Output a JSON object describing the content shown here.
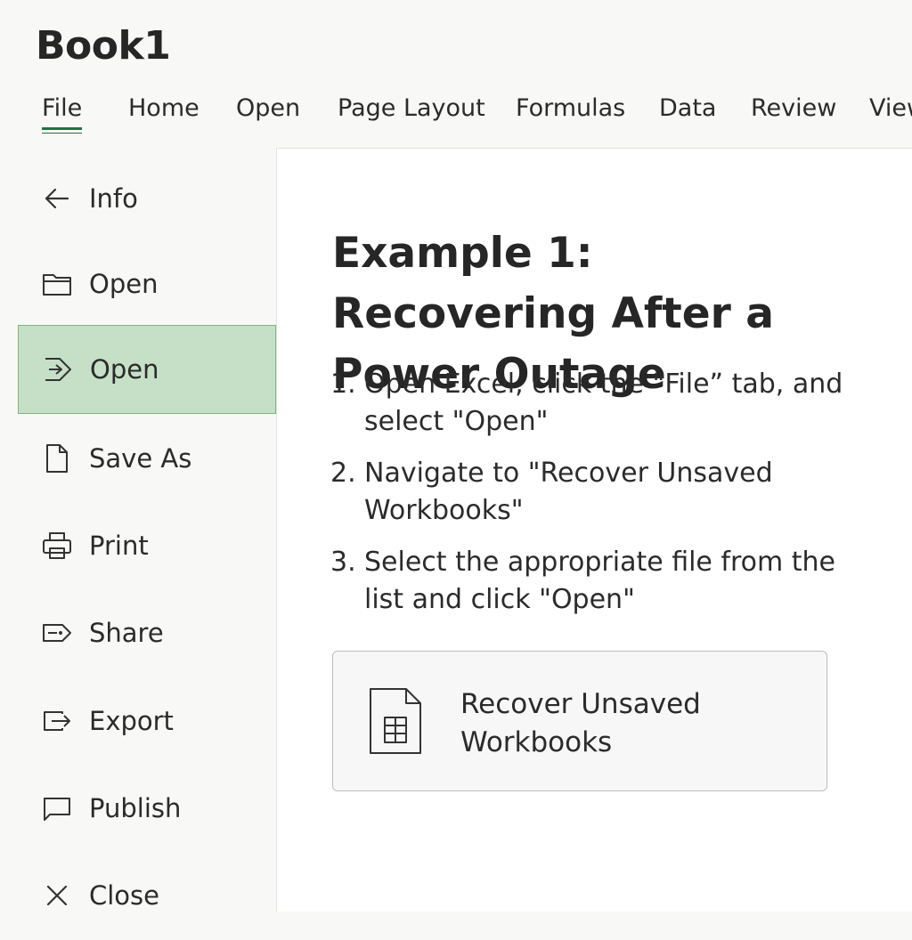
{
  "app": {
    "title": "Book1"
  },
  "ribbon": {
    "tabs": [
      {
        "label": "File"
      },
      {
        "label": "Home"
      },
      {
        "label": "Open"
      },
      {
        "label": "Page Layout"
      },
      {
        "label": "Formulas"
      },
      {
        "label": "Data"
      },
      {
        "label": "Review"
      },
      {
        "label": "View"
      }
    ],
    "active_tab": "File"
  },
  "sidebar": {
    "items": [
      {
        "label": "Info",
        "icon": "back-arrow-icon"
      },
      {
        "label": "Open",
        "icon": "folder-icon"
      },
      {
        "label": "Open",
        "icon": "open-arrow-icon",
        "selected": true
      },
      {
        "label": "Save As",
        "icon": "document-icon"
      },
      {
        "label": "Print",
        "icon": "printer-icon"
      },
      {
        "label": "Share",
        "icon": "share-icon"
      },
      {
        "label": "Export",
        "icon": "export-icon"
      },
      {
        "label": "Publish",
        "icon": "publish-icon"
      },
      {
        "label": "Close",
        "icon": "close-icon"
      }
    ]
  },
  "main": {
    "heading": "Example 1: Recovering After a Power Outage",
    "steps": [
      {
        "num": "1.",
        "text": "Open Excel, click the \"File” tab, and select \"Open\""
      },
      {
        "num": "2.",
        "text": "Navigate to \"Recover Unsaved Workbooks\""
      },
      {
        "num": "3.",
        "text": "Select the appropriate file from the list and click \"Open\""
      }
    ],
    "recover_button": {
      "label": "Recover Unsaved Workbooks",
      "icon": "spreadsheet-file-icon"
    }
  },
  "colors": {
    "accent": "#217346",
    "selected_bg": "#c6e0c8",
    "selected_border": "#7fb47f",
    "background": "#f8f8f6"
  }
}
